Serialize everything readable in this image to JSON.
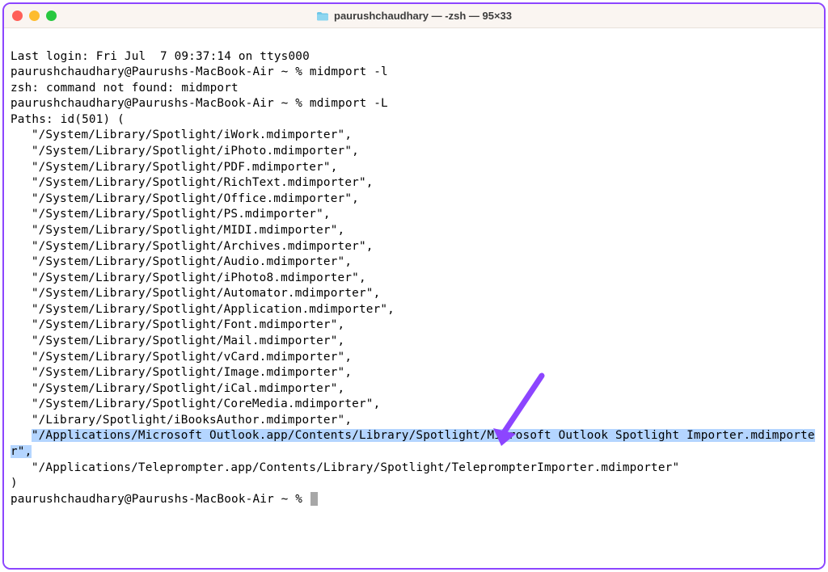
{
  "window": {
    "title": "paurushchaudhary — -zsh — 95×33"
  },
  "terminal": {
    "last_login": "Last login: Fri Jul  7 09:37:14 on ttys000",
    "prompt1_prefix": "paurushchaudhary@Paurushs-MacBook-Air ~ % ",
    "cmd1": "midmport -l",
    "err1": "zsh: command not found: midmport",
    "prompt2_prefix": "paurushchaudhary@Paurushs-MacBook-Air ~ % ",
    "cmd2": "mdimport -L",
    "paths_header": "Paths: id(501) (",
    "paths": [
      "\"/System/Library/Spotlight/iWork.mdimporter\",",
      "\"/System/Library/Spotlight/iPhoto.mdimporter\",",
      "\"/System/Library/Spotlight/PDF.mdimporter\",",
      "\"/System/Library/Spotlight/RichText.mdimporter\",",
      "\"/System/Library/Spotlight/Office.mdimporter\",",
      "\"/System/Library/Spotlight/PS.mdimporter\",",
      "\"/System/Library/Spotlight/MIDI.mdimporter\",",
      "\"/System/Library/Spotlight/Archives.mdimporter\",",
      "\"/System/Library/Spotlight/Audio.mdimporter\",",
      "\"/System/Library/Spotlight/iPhoto8.mdimporter\",",
      "\"/System/Library/Spotlight/Automator.mdimporter\",",
      "\"/System/Library/Spotlight/Application.mdimporter\",",
      "\"/System/Library/Spotlight/Font.mdimporter\",",
      "\"/System/Library/Spotlight/Mail.mdimporter\",",
      "\"/System/Library/Spotlight/vCard.mdimporter\",",
      "\"/System/Library/Spotlight/Image.mdimporter\",",
      "\"/System/Library/Spotlight/iCal.mdimporter\",",
      "\"/System/Library/Spotlight/CoreMedia.mdimporter\",",
      "\"/Library/Spotlight/iBooksAuthor.mdimporter\","
    ],
    "highlight_line": "\"/Applications/Microsoft Outlook.app/Contents/Library/Spotlight/Microsoft Outlook Spotlight Importer.mdimporter\",",
    "post_highlight": "\"/Applications/Teleprompter.app/Contents/Library/Spotlight/TeleprompterImporter.mdimporter\"",
    "paths_close": ")",
    "prompt3_prefix": "paurushchaudhary@Paurushs-MacBook-Air ~ % "
  },
  "annotation": {
    "arrow_color": "#8c45ff"
  }
}
